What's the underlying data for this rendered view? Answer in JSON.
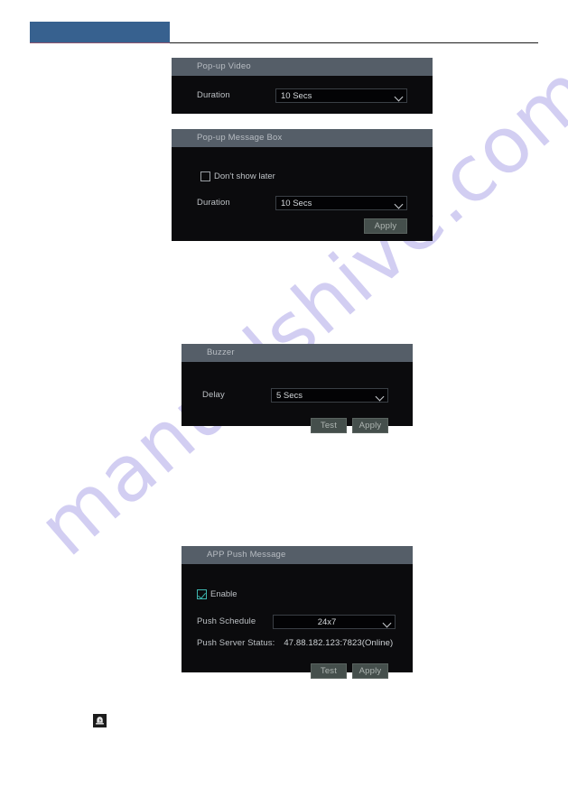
{
  "page": {
    "watermark_text": "manualshive.com",
    "header_accent_color": "#37618f"
  },
  "panels": [
    {
      "id": "popup-video",
      "title": "Pop-up Video",
      "duration_label": "Duration",
      "duration_value": "10 Secs"
    },
    {
      "id": "popup-message-box",
      "title": "Pop-up Message Box",
      "dont_show_label": "Don't show later",
      "dont_show_checked": false,
      "duration_label": "Duration",
      "duration_value": "10 Secs",
      "apply_label": "Apply"
    },
    {
      "id": "buzzer",
      "title": "Buzzer",
      "delay_label": "Delay",
      "delay_value": "5 Secs",
      "test_label": "Test",
      "apply_label": "Apply"
    },
    {
      "id": "app-push-message",
      "title": "APP Push Message",
      "enable_label": "Enable",
      "enable_checked": true,
      "schedule_label": "Push Schedule",
      "schedule_value": "24x7",
      "server_status_label": "Push Server Status:",
      "server_status_value": "47.88.182.123:7823(Online)",
      "test_label": "Test",
      "apply_label": "Apply"
    }
  ],
  "footer": {
    "icon_name": "buzzer-icon"
  }
}
